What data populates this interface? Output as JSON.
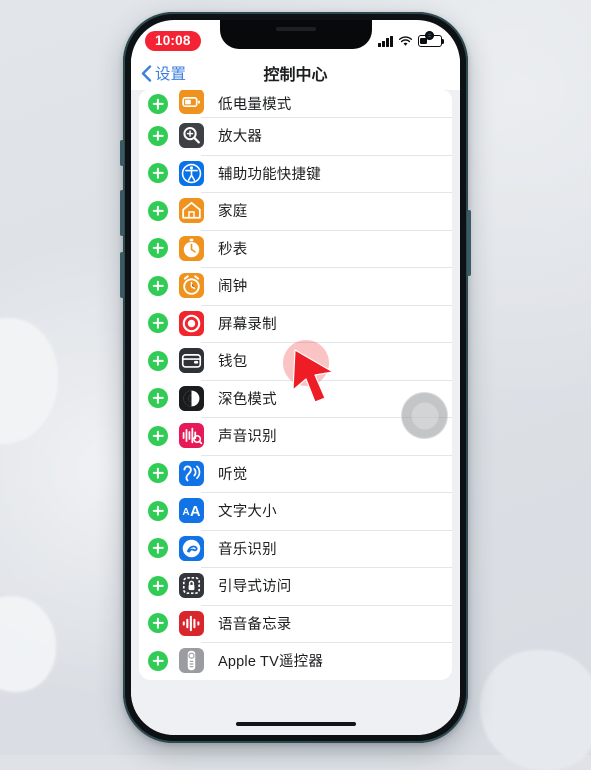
{
  "status_bar": {
    "time": "10:08",
    "time_pill_color": "#f42232",
    "signal_icon": "cellular-signal-icon",
    "wifi_icon": "wifi-icon",
    "battery_icon": "battery-low-icon",
    "battery_percent": 35
  },
  "nav": {
    "back_label": "设置",
    "back_chevron": "chevron-left-icon",
    "title": "控制中心",
    "accent_color": "#3d7fe0"
  },
  "list": {
    "add_button_color": "#31cc55",
    "rows": [
      {
        "label": "低电量模式",
        "icon": "low-power-mode-icon",
        "icon_bg": "#f0931e",
        "partial": true
      },
      {
        "label": "放大器",
        "icon": "magnifier-icon",
        "icon_bg": "#3d4146",
        "partial": false
      },
      {
        "label": "辅助功能快捷键",
        "icon": "accessibility-shortcut-icon",
        "icon_bg": "#0a72e8",
        "partial": false
      },
      {
        "label": "家庭",
        "icon": "home-app-icon",
        "icon_bg": "#f0931e",
        "partial": false
      },
      {
        "label": "秒表",
        "icon": "stopwatch-icon",
        "icon_bg": "#f0931e",
        "partial": false
      },
      {
        "label": "闹钟",
        "icon": "alarm-clock-icon",
        "icon_bg": "#f0931e",
        "partial": false
      },
      {
        "label": "屏幕录制",
        "icon": "screen-record-icon",
        "icon_bg": "#f0262f",
        "partial": false
      },
      {
        "label": "钱包",
        "icon": "wallet-icon",
        "icon_bg": "#2e3135",
        "partial": false
      },
      {
        "label": "深色模式",
        "icon": "dark-mode-icon",
        "icon_bg": "#1a1c1e",
        "partial": false
      },
      {
        "label": "声音识别",
        "icon": "sound-recognition-icon",
        "icon_bg": "#e51a56",
        "partial": false
      },
      {
        "label": "听觉",
        "icon": "hearing-icon",
        "icon_bg": "#1273e6",
        "partial": false
      },
      {
        "label": "文字大小",
        "icon": "text-size-icon",
        "icon_bg": "#1273e6",
        "partial": false
      },
      {
        "label": "音乐识别",
        "icon": "music-recognition-icon",
        "icon_bg": "#1273e6",
        "partial": false
      },
      {
        "label": "引导式访问",
        "icon": "guided-access-icon",
        "icon_bg": "#33373b",
        "partial": false
      },
      {
        "label": "语音备忘录",
        "icon": "voice-memos-icon",
        "icon_bg": "#d8262c",
        "partial": false
      },
      {
        "label": "Apple TV遥控器",
        "icon": "apple-tv-remote-icon",
        "icon_bg": "#9a9ca0",
        "partial": false
      }
    ]
  },
  "overlay": {
    "assistive_touch": "assistive-touch-button",
    "cursor": "red-pointer-cursor",
    "tap_target_row": "屏幕录制"
  },
  "home_indicator": "home-indicator-bar"
}
